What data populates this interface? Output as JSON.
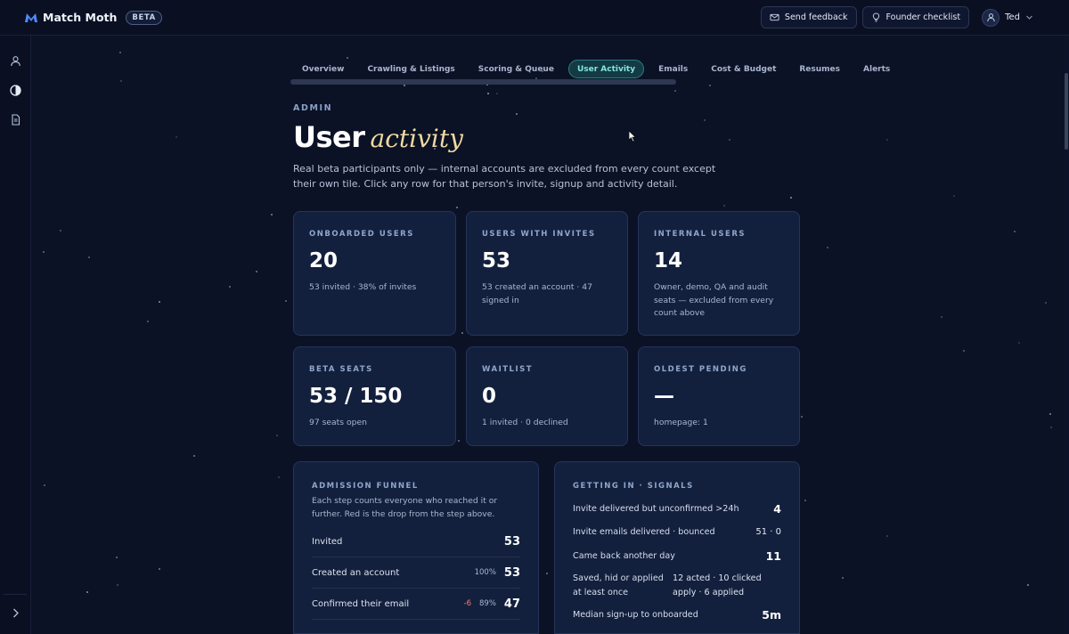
{
  "brand": {
    "name": "Match Moth",
    "badge": "BETA"
  },
  "topbar": {
    "feedback_label": "Send feedback",
    "checklist_label": "Founder checklist",
    "user_name": "Ted"
  },
  "tabs": [
    {
      "label": "Overview",
      "active": false
    },
    {
      "label": "Crawling & Listings",
      "active": false
    },
    {
      "label": "Scoring & Queue",
      "active": false
    },
    {
      "label": "User Activity",
      "active": true
    },
    {
      "label": "Emails",
      "active": false
    },
    {
      "label": "Cost & Budget",
      "active": false
    },
    {
      "label": "Resumes",
      "active": false
    },
    {
      "label": "Alerts",
      "active": false
    }
  ],
  "header": {
    "eyebrow": "ADMIN",
    "title_main": "User",
    "title_accent": "activity",
    "subtitle": "Real beta participants only — internal accounts are excluded from every count except their own tile. Click any row for that person's invite, signup and activity detail."
  },
  "cards": [
    {
      "label": "ONBOARDED USERS",
      "value": "20",
      "note": "53 invited · 38% of invites"
    },
    {
      "label": "USERS WITH INVITES",
      "value": "53",
      "note": "53 created an account · 47 signed in"
    },
    {
      "label": "INTERNAL USERS",
      "value": "14",
      "note": "Owner, demo, QA and audit seats — excluded from every count above"
    },
    {
      "label": "BETA SEATS",
      "value": "53 / 150",
      "note": "97 seats open"
    },
    {
      "label": "WAITLIST",
      "value": "0",
      "note": "1 invited · 0 declined"
    },
    {
      "label": "OLDEST PENDING",
      "value": "—",
      "note": "homepage: 1"
    }
  ],
  "funnel": {
    "title": "ADMISSION FUNNEL",
    "desc": "Each step counts everyone who reached it or further. Red is the drop from the step above.",
    "rows": [
      {
        "label": "Invited",
        "drop": "",
        "pct": "",
        "count": "53"
      },
      {
        "label": "Created an account",
        "drop": "",
        "pct": "100%",
        "count": "53"
      },
      {
        "label": "Confirmed their email",
        "drop": "-6",
        "pct": "89%",
        "count": "47"
      }
    ]
  },
  "signals": {
    "title": "GETTING IN · SIGNALS",
    "rows": [
      {
        "label": "Invite delivered but unconfirmed >24h",
        "mid": "",
        "value": "4"
      },
      {
        "label": "Invite emails delivered · bounced",
        "mid": "",
        "value": "51 · 0"
      },
      {
        "label": "Came back another day",
        "mid": "",
        "value": "11"
      },
      {
        "label": "Saved, hid or applied at least once",
        "mid": "12 acted · 10 clicked apply · 6 applied",
        "value": ""
      },
      {
        "label": "Median sign-up to onboarded",
        "mid": "",
        "value": "5m"
      }
    ]
  },
  "icons": [
    "logo-icon",
    "mail-icon",
    "lightbulb-icon",
    "user-icon",
    "chevron-down-icon",
    "person-icon",
    "contrast-icon",
    "document-icon",
    "chevron-right-icon",
    "cursor-icon"
  ]
}
